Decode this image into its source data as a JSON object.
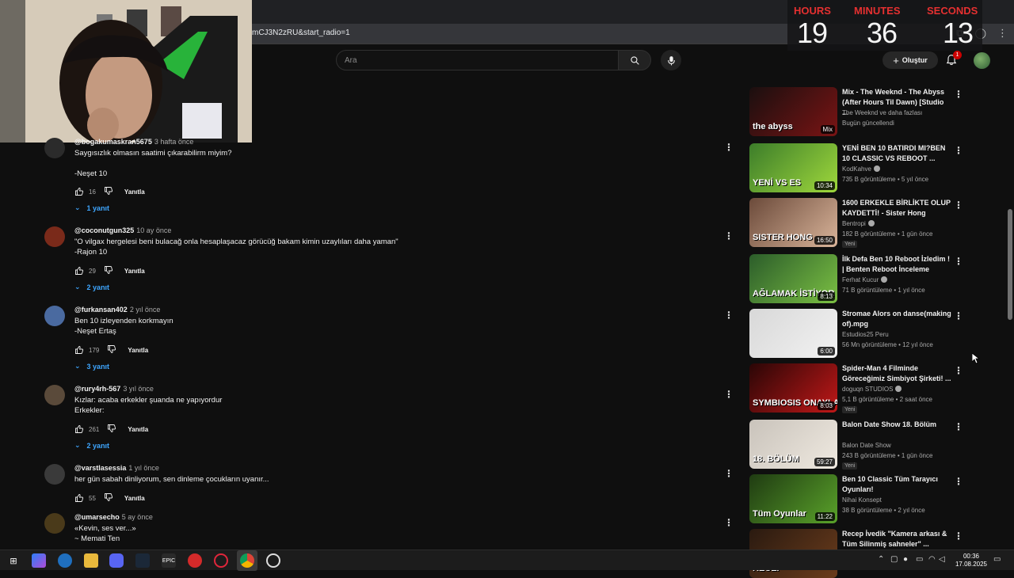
{
  "browser": {
    "url": "mCJ3N2zRU&start_radio=1"
  },
  "clock": {
    "hours_label": "HOURS",
    "minutes_label": "MINUTES",
    "seconds_label": "SECONDS",
    "hours": "19",
    "minutes": "36",
    "seconds": "13"
  },
  "header": {
    "search_placeholder": "Ara",
    "create_label": "Oluştur",
    "notification_count": "1"
  },
  "comments": [
    {
      "author": "@bogakumaskran5675",
      "date": "3 hafta önce",
      "lines": [
        "Saygısızlık olmasın saatimi çıkarabilirm miyim?",
        "",
        "-Neşet 10"
      ],
      "likes": "16",
      "reply_label": "Yanıtla",
      "replies": "1 yanıt"
    },
    {
      "author": "@coconutgun325",
      "date": "10 ay önce",
      "lines": [
        "\"O vilgax hergelesi beni bulacağ onla hesaplaşacaz görücüğ bakam kimin uzaylıları daha yaman\"",
        "-Rajon 10"
      ],
      "likes": "29",
      "reply_label": "Yanıtla",
      "replies": "2 yanıt"
    },
    {
      "author": "@furkansan402",
      "date": "2 yıl önce",
      "lines": [
        "Ben 10 izleyenden korkmayın",
        "-Neşet Ertaş"
      ],
      "likes": "179",
      "reply_label": "Yanıtla",
      "replies": "3 yanıt"
    },
    {
      "author": "@rury4rh-567",
      "date": "3 yıl önce",
      "lines": [
        "Kızlar: acaba erkekler şuanda ne yapıyordur",
        "Erkekler:"
      ],
      "likes": "261",
      "reply_label": "Yanıtla",
      "replies": "2 yanıt"
    },
    {
      "author": "@varstlasessia",
      "date": "1 yıl önce",
      "lines": [
        "her gün sabah dinliyorum, sen dinleme çocukların uyanır..."
      ],
      "likes": "55",
      "reply_label": "Yanıtla",
      "replies": ""
    },
    {
      "author": "@umarsecho",
      "date": "5 ay önce",
      "lines": [
        "«Kevin, ses ver...»",
        "~      Memati Ten"
      ],
      "likes": "",
      "reply_label": "",
      "replies": ""
    }
  ],
  "playlist": [
    {
      "title": "Mix - The Weeknd - The Abyss (After Hours Til Dawn) [Studio ...",
      "channel": "The Weeknd ve daha fazlası",
      "meta": "Bugün güncellendi",
      "duration": "Mix",
      "new": "",
      "thumb_text": "the abyss",
      "thumb_colors": [
        "#1a0f0f",
        "#7a1414"
      ]
    },
    {
      "title": "YENİ BEN 10 BATIRDI MI?BEN 10 CLASSIC VS REBOOT ...",
      "channel": "KodKahve",
      "meta": "735 B görüntüleme • 5 yıl önce",
      "duration": "10:34",
      "new": "",
      "thumb_text": "YENİ VS ES",
      "thumb_colors": [
        "#3c7d2a",
        "#9fd83c"
      ]
    },
    {
      "title": "1600 ERKEKLE BİRLİKTE OLUP KAYDETTİ! - Sister Hong",
      "channel": "Bentropi",
      "meta": "182 B görüntüleme • 1 gün önce",
      "duration": "16:50",
      "new": "Yeni",
      "thumb_text": "SISTER HONG",
      "thumb_colors": [
        "#6b4a3a",
        "#d9b49a"
      ]
    },
    {
      "title": "İlk Defa Ben 10 Reboot İzledim ! | Benten Reboot İnceleme",
      "channel": "Ferhat Kucur",
      "meta": "71 B görüntüleme • 1 yıl önce",
      "duration": "8:13",
      "new": "",
      "thumb_text": "AĞLAMAK İSTİYOR",
      "thumb_colors": [
        "#2b5c2a",
        "#7bc043"
      ]
    },
    {
      "title": "Stromae   Alors on danse(making of).mpg",
      "channel": "Estudios25 Peru",
      "meta": "56 Mn görüntüleme • 12 yıl önce",
      "duration": "6:00",
      "new": "",
      "thumb_text": "",
      "thumb_colors": [
        "#d8d8d8",
        "#f2f2f2"
      ]
    },
    {
      "title": "Spider-Man 4 Filminde Göreceğimiz Simbiyot Şirketi! ...",
      "channel": "doguqn STUDIOS",
      "meta": "5,1 B görüntüleme • 2 saat önce",
      "duration": "8:03",
      "new": "Yeni",
      "thumb_text": "SYMBIOSIS ONAYLANDI",
      "thumb_colors": [
        "#2a0606",
        "#c01818"
      ]
    },
    {
      "title": "Balon Date Show 18. Bölüm",
      "channel": "Balon Date Show",
      "meta": "243 B görüntüleme • 1 gün önce",
      "duration": "59:27",
      "new": "Yeni",
      "thumb_text": "18. BÖLÜM",
      "thumb_colors": [
        "#c9c3bb",
        "#efe9e0"
      ]
    },
    {
      "title": "Ben 10 Classic Tüm Tarayıcı Oyunları!",
      "channel": "Nihai Konsept",
      "meta": "38 B görüntüleme • 2 yıl önce",
      "duration": "11:22",
      "new": "",
      "thumb_text": "Tüm Oyunlar",
      "thumb_colors": [
        "#1f3b12",
        "#5aa22a"
      ]
    },
    {
      "title": "Recep İvedik \"Kamera arkası & Tüm Silinmiş sahneler\" ...",
      "channel": "",
      "meta": "",
      "duration": "",
      "new": "",
      "thumb_text": "RECEP",
      "thumb_colors": [
        "#2a1a10",
        "#6b3c1c"
      ]
    }
  ],
  "taskbar": {
    "time": "00:36",
    "date": "17.08.2025"
  }
}
